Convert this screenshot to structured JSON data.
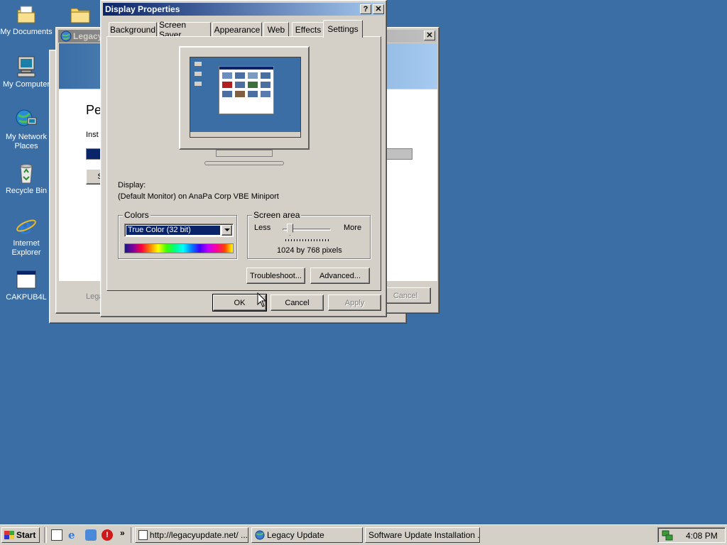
{
  "desktop": {
    "icons": [
      {
        "label": "My Documents",
        "icon": "my-documents-icon"
      },
      {
        "label": "",
        "icon": "folder-icon"
      },
      {
        "label": "My Computer",
        "icon": "my-computer-icon"
      },
      {
        "label": "My Network Places",
        "icon": "network-places-icon"
      },
      {
        "label": "Recycle Bin",
        "icon": "recycle-bin-icon"
      },
      {
        "label": "Internet Explorer",
        "icon": "internet-explorer-icon"
      },
      {
        "label": "CAKPUB4L",
        "icon": "application-icon"
      }
    ]
  },
  "background_windows": {
    "legacy_title": "Legacy",
    "heading_partial": "Pe",
    "text_partial": "Inst",
    "button_partial": "S",
    "footer_partial": "Lega",
    "cancel_label": "Cancel"
  },
  "dialog": {
    "title": "Display Properties",
    "help_button": "?",
    "close_button": "✕",
    "tabs": [
      "Background",
      "Screen Saver",
      "Appearance",
      "Web",
      "Effects",
      "Settings"
    ],
    "active_tab": "Settings",
    "display_label": "Display:",
    "display_value": "(Default Monitor) on AnaPa Corp VBE Miniport",
    "colors": {
      "label": "Colors",
      "selected": "True Color (32 bit)"
    },
    "screen_area": {
      "label": "Screen area",
      "less": "Less",
      "more": "More",
      "value": "1024 by 768 pixels",
      "slider_level": 0.1
    },
    "troubleshoot_label": "Troubleshoot...",
    "advanced_label": "Advanced...",
    "ok_label": "OK",
    "cancel_label": "Cancel",
    "apply_label": "Apply"
  },
  "taskbar": {
    "start_label": "Start",
    "quicklaunch_chevron": "»",
    "tasks": [
      {
        "label": "http://legacyupdate.net/ ...",
        "icon": "ie-page-icon"
      },
      {
        "label": "Legacy Update",
        "icon": "globe-icon"
      },
      {
        "label": "Software Update Installation ...",
        "icon": ""
      }
    ],
    "clock": "4:08 PM"
  },
  "colors": {
    "desktop": "#3a6ea5",
    "title_active": "#0a246a",
    "title_gradient_end": "#a6caf0",
    "title_inactive": "#808080",
    "face": "#d4d0c8",
    "selection": "#0a246a"
  }
}
